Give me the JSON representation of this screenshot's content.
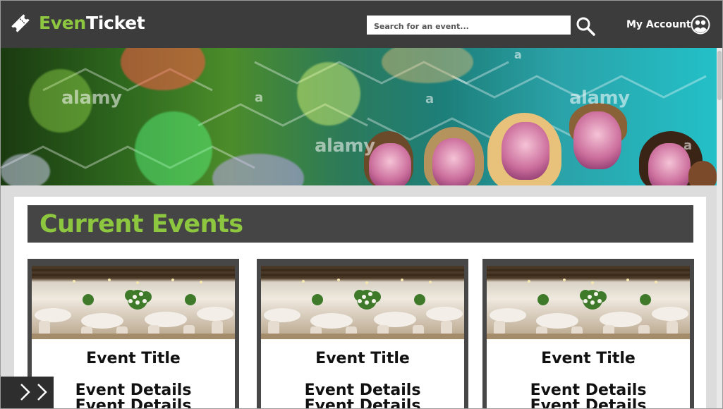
{
  "header": {
    "brand_part1": "Even",
    "brand_part2": "Ticket",
    "search_placeholder": "Search for an event...",
    "account_label": "My Account",
    "icons": [
      "ticket-logo-icon",
      "search-icon",
      "user-avatar-icon"
    ]
  },
  "hero": {
    "watermarks": [
      "alamy",
      "a",
      "alamy",
      "alamy",
      "a",
      "a",
      "a"
    ]
  },
  "section": {
    "title": "Current Events"
  },
  "events": [
    {
      "title": "Event Title",
      "details": "Event Details",
      "details_2": "Event Details"
    },
    {
      "title": "Event Title",
      "details": "Event Details",
      "details_2": "Event Details"
    },
    {
      "title": "Event Title",
      "details": "Event Details",
      "details_2": "Event Details"
    }
  ],
  "nav": {
    "icon": "double-chevron-right-icon"
  },
  "colors": {
    "header_bg": "#3c3c3c",
    "accent_green": "#8dc63f",
    "section_bar": "#454545",
    "card_frame": "#474747",
    "page_bg": "#dcdcdc"
  }
}
